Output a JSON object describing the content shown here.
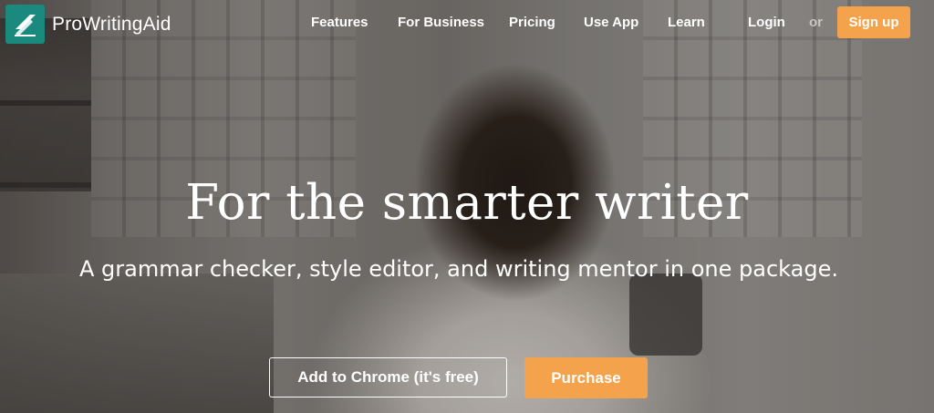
{
  "brand": {
    "name": "ProWritingAid",
    "icon": "quill-pages-icon",
    "color": "#1b8a7e"
  },
  "nav": {
    "items": [
      "Features",
      "For Business",
      "Pricing",
      "Use App",
      "Learn"
    ],
    "login": "Login",
    "or": "or",
    "signup": "Sign up"
  },
  "hero": {
    "headline": "For the smarter writer",
    "subheadline": "A grammar checker, style editor, and writing mentor in one package.",
    "cta_secondary": "Add to Chrome (it's free)",
    "cta_primary": "Purchase"
  },
  "colors": {
    "accent": "#f4a24b",
    "text": "#ffffff"
  }
}
